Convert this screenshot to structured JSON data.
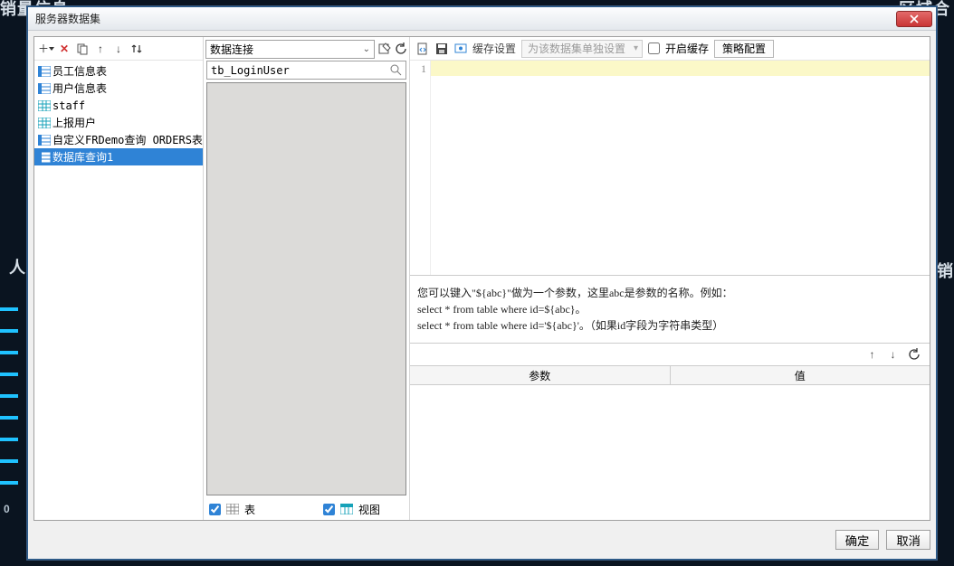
{
  "dialog": {
    "title": "服务器数据集"
  },
  "bg": {
    "top_left": "销量信息",
    "top_right": "区域合",
    "right_mid": "销",
    "left_mid": "人",
    "zero": "0"
  },
  "left_toolbar": {
    "add": "＋",
    "delete": "✕",
    "copy": "⎘",
    "up": "↑",
    "down": "↓",
    "sort": "⇵"
  },
  "tree_items": [
    {
      "label": "员工信息表",
      "type": "report"
    },
    {
      "label": "用户信息表",
      "type": "report"
    },
    {
      "label": "staff",
      "type": "table"
    },
    {
      "label": "上报用户",
      "type": "table"
    },
    {
      "label": "自定义FRDemo查询 ORDERS表",
      "type": "report"
    },
    {
      "label": "数据库查询1",
      "type": "report",
      "selected": true
    }
  ],
  "mid": {
    "combo_label": "数据连接",
    "search_value": "tb_LoginUser",
    "chk_table": "表",
    "chk_view": "视图"
  },
  "right": {
    "cache_label": "缓存设置",
    "cache_dd": "为该数据集单独设置",
    "enable_cache": "开启缓存",
    "strategy": "策略配置",
    "gutter_1": "1",
    "hint_line1": "您可以键入\"${abc}\"做为一个参数，这里abc是参数的名称。例如：",
    "hint_line2": "select * from table where id=${abc}。",
    "hint_line3": "select * from table where id='${abc}'。（如果id字段为字符串类型）",
    "col_param": "参数",
    "col_value": "值"
  },
  "footer": {
    "ok": "确定",
    "cancel": "取消"
  }
}
